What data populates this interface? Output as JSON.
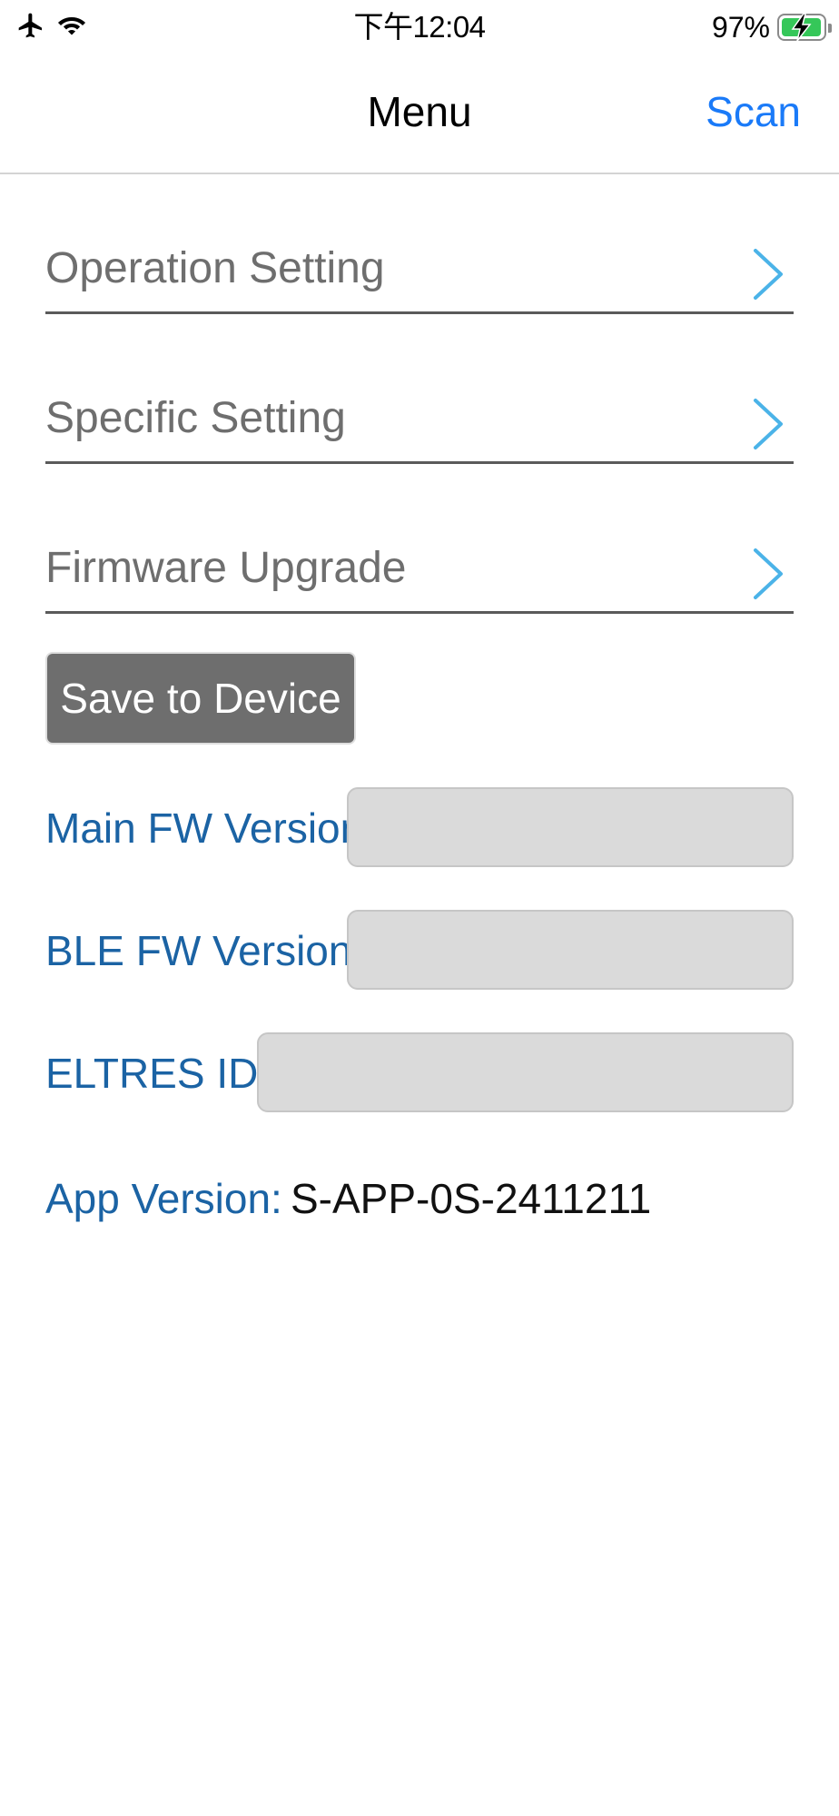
{
  "status_bar": {
    "time": "下午12:04",
    "battery_percent_label": "97%",
    "battery_level": 0.97,
    "left_icons": [
      "airplane-icon",
      "wifi-icon"
    ],
    "battery_state": "charging"
  },
  "nav": {
    "title": "Menu",
    "scan_label": "Scan"
  },
  "menu_items": [
    {
      "label": "Operation Setting"
    },
    {
      "label": "Specific Setting"
    },
    {
      "label": "Firmware Upgrade"
    }
  ],
  "save_button_label": "Save to Device",
  "info": {
    "main_fw_label": "Main FW Version:",
    "main_fw_value": "",
    "ble_fw_label": "BLE FW Version:",
    "ble_fw_value": "",
    "eltres_id_label": "ELTRES ID:",
    "eltres_id_value": "",
    "app_version_label": "App Version:",
    "app_version_value": "S-APP-0S-2411211"
  },
  "colors": {
    "accent_blue": "#1a7af8",
    "label_blue": "#1b63a4",
    "chevron": "#4bb3e8",
    "menu_text": "#6e6e6e",
    "button_bg": "#6e6e6e",
    "battery_green": "#35c759"
  }
}
